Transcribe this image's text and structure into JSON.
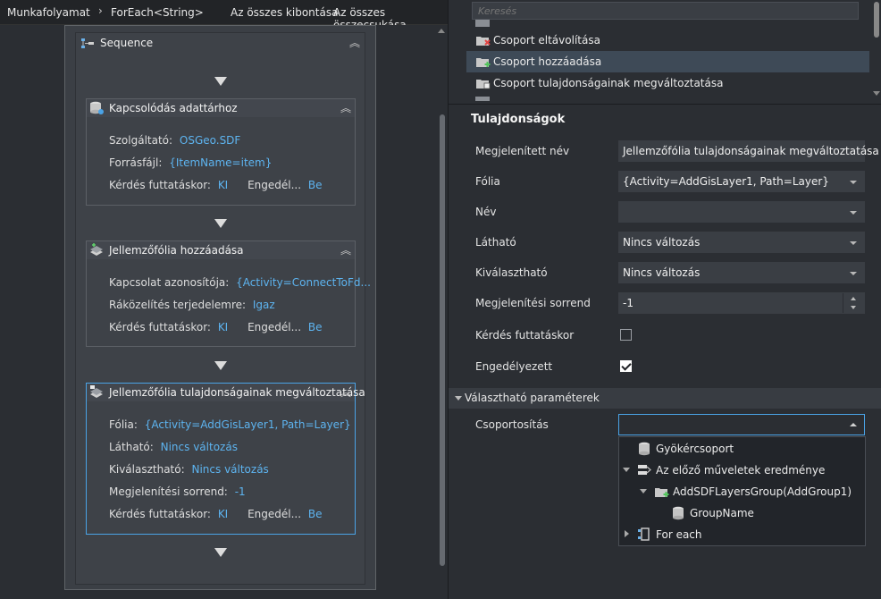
{
  "breadcrumb": {
    "root": "Munkafolyamat",
    "current": "ForEach<String>",
    "expand_all": "Az összes kibontása",
    "collapse_all": "Az összes összecsukása"
  },
  "sequence": {
    "title": "Sequence"
  },
  "cards": [
    {
      "title": "Kapcsolódás adattárhoz",
      "rows": [
        {
          "label": "Szolgáltató:",
          "value": "OSGeo.SDF"
        },
        {
          "label": "Forrásfájl:",
          "value": "{ItemName=item}"
        },
        {
          "label": "Kérdés futtatáskor:",
          "value": "KI",
          "label2": "Engedél...",
          "value2": "Be"
        }
      ]
    },
    {
      "title": "Jellemzőfólia hozzáadása",
      "rows": [
        {
          "label": "Kapcsolat azonosítója:",
          "value": "{Activity=ConnectToFd..."
        },
        {
          "label": "Ráközelítés terjedelemre:",
          "value": "Igaz"
        },
        {
          "label": "Kérdés futtatáskor:",
          "value": "KI",
          "label2": "Engedél...",
          "value2": "Be"
        }
      ]
    },
    {
      "title": "Jellemzőfólia tulajdonságainak megváltoztatása",
      "rows": [
        {
          "label": "Fólia:",
          "value": "{Activity=AddGisLayer1, Path=Layer}"
        },
        {
          "label": "Látható:",
          "value": "Nincs változás"
        },
        {
          "label": "Kiválasztható:",
          "value": "Nincs változás"
        },
        {
          "label": "Megjelenítési sorrend:",
          "value": "-1"
        },
        {
          "label": "Kérdés futtatáskor:",
          "value": "KI",
          "label2": "Engedél...",
          "value2": "Be"
        }
      ]
    }
  ],
  "activity_list": {
    "search_placeholder": "Keresés",
    "items": [
      {
        "label": "Csoport eltávolítása",
        "icon": "remove-group-icon"
      },
      {
        "label": "Csoport hozzáadása",
        "icon": "add-group-icon",
        "selected": true
      },
      {
        "label": "Csoport tulajdonságainak megváltoztatása",
        "icon": "change-group-icon"
      }
    ]
  },
  "properties": {
    "title": "Tulajdonságok",
    "fields": [
      {
        "label": "Megjelenített név",
        "value": "Jellemzőfólia tulajdonságainak megváltoztatása",
        "kind": "text"
      },
      {
        "label": "Fólia",
        "value": "{Activity=AddGisLayer1, Path=Layer}",
        "kind": "dropdown"
      },
      {
        "label": "Név",
        "value": "",
        "kind": "dropdown"
      },
      {
        "label": "Látható",
        "value": "Nincs változás",
        "kind": "dropdown"
      },
      {
        "label": "Kiválasztható",
        "value": "Nincs változás",
        "kind": "dropdown"
      },
      {
        "label": "Megjelenítési sorrend",
        "value": "-1",
        "kind": "spinner"
      },
      {
        "label": "Kérdés futtatáskor",
        "checked": false,
        "kind": "checkbox"
      },
      {
        "label": "Engedélyezett",
        "checked": true,
        "kind": "checkbox"
      }
    ],
    "section": "Választható paraméterek",
    "grouping_label": "Csoportosítás",
    "grouping_value": ""
  },
  "tree": [
    {
      "label": "Gyökércsoport",
      "icon": "database-icon",
      "level": 0,
      "expander": "none"
    },
    {
      "label": "Az előző műveletek eredménye",
      "icon": "results-icon",
      "level": 0,
      "expander": "open"
    },
    {
      "label": "AddSDFLayersGroup(AddGroup1)",
      "icon": "add-group-icon",
      "level": 1,
      "expander": "open"
    },
    {
      "label": "GroupName",
      "icon": "database-icon",
      "level": 2,
      "expander": "none"
    },
    {
      "label": "For each",
      "icon": "foreach-icon",
      "level": 0,
      "expander": "closed"
    }
  ],
  "colors": {
    "accent": "#4aa3e6",
    "value_text": "#5db4f0",
    "background": "#2b2e33"
  }
}
